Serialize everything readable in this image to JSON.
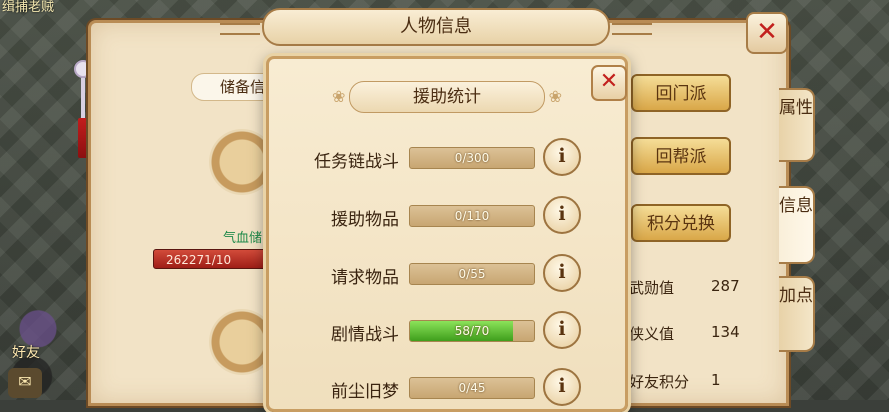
{
  "world": {
    "top_left_text": "缉捕老贼",
    "top_center_text": "",
    "friends_label": "好友"
  },
  "panel": {
    "title": "人物信息",
    "close_glyph": "✕",
    "reserve_label": "储备信",
    "hp_label": "气血储",
    "hp_value": "262271/10",
    "buttons": [
      "回门派",
      "回帮派",
      "积分兑换"
    ],
    "stats": [
      {
        "label": "武勋值",
        "value": "287"
      },
      {
        "label": "侠义值",
        "value": "134"
      },
      {
        "label": "好友积分",
        "value": "1"
      }
    ],
    "side_tabs": [
      "属性",
      "信息",
      "加点"
    ]
  },
  "dialog": {
    "title": "援助统计",
    "close_glyph": "✕",
    "info_glyph": "i",
    "rows": [
      {
        "label": "任务链战斗",
        "text": "0/300",
        "progress": 0
      },
      {
        "label": "援助物品",
        "text": "0/110",
        "progress": 0
      },
      {
        "label": "请求物品",
        "text": "0/55",
        "progress": 0
      },
      {
        "label": "剧情战斗",
        "text": "58/70",
        "progress": 0.829
      },
      {
        "label": "前尘旧梦",
        "text": "0/45",
        "progress": 0
      }
    ]
  },
  "colors": {
    "panel_bg": "#f2e3c6",
    "close_red": "#c2201d",
    "progress_green": "#3f9e1c"
  }
}
